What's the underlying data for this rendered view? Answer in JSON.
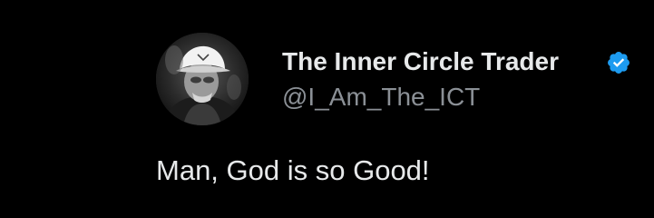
{
  "author": {
    "display_name": "The Inner Circle Trader",
    "handle": "@I_Am_The_ICT",
    "verified": true,
    "avatar_icon": "profile-photo-icon"
  },
  "tweet": {
    "text": "Man, God is so Good!"
  },
  "colors": {
    "background": "#000000",
    "text_primary": "#e7e9ea",
    "text_secondary": "#8b9096",
    "verified_badge": "#1d9bf0"
  }
}
